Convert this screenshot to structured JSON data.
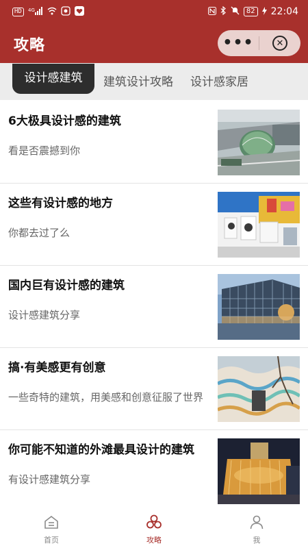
{
  "status_bar": {
    "left_chip": "HD",
    "signal": "4G",
    "time": "22:04",
    "battery": "82"
  },
  "header": {
    "title": "攻略",
    "more_label": "•••"
  },
  "tabs": [
    {
      "label": "设计感建筑",
      "active": true
    },
    {
      "label": "建筑设计攻略",
      "active": false
    },
    {
      "label": "设计感家居",
      "active": false
    }
  ],
  "articles": [
    {
      "title": "6大极具设计感的建筑",
      "subtitle": "看是否震撼到你",
      "image_icon": "dome-building-image"
    },
    {
      "title": "这些有设计感的地方",
      "subtitle": "你都去过了么",
      "image_icon": "colorful-building-image"
    },
    {
      "title": "国内巨有设计感的建筑",
      "subtitle": "设计感建筑分享",
      "image_icon": "glass-building-image"
    },
    {
      "title": "搞·有美感更有创意",
      "subtitle": "一些奇特的建筑，用美感和创意征服了世界",
      "image_icon": "wavy-building-image"
    },
    {
      "title": "你可能不知道的外滩最具设计的建筑",
      "subtitle": "有设计感建筑分享",
      "image_icon": "golden-building-image"
    }
  ],
  "bottom_nav": [
    {
      "label": "首页",
      "icon": "home-icon",
      "active": false
    },
    {
      "label": "攻略",
      "icon": "guide-icon",
      "active": true
    },
    {
      "label": "我",
      "icon": "profile-icon",
      "active": false
    }
  ],
  "colors": {
    "primary": "#a8302c",
    "tab_bar_bg": "#ececec",
    "active_tab_bg": "#2d2d2d"
  }
}
